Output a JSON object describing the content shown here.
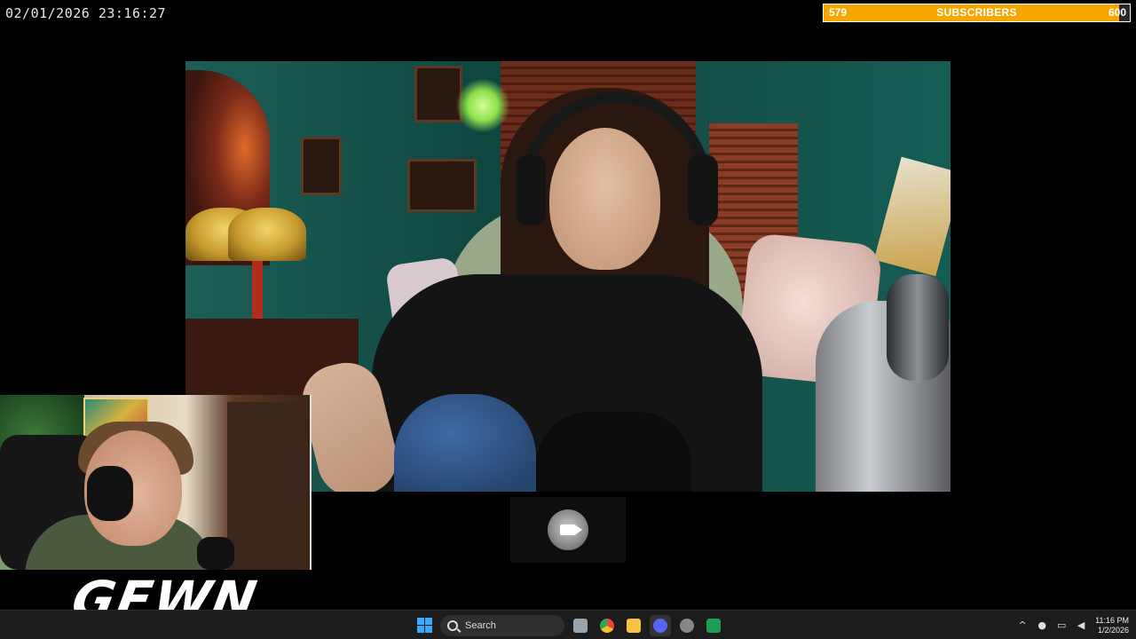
{
  "overlay": {
    "timestamp": "02/01/2026 23:16:27",
    "subscribers": {
      "current": "579",
      "label": "SUBSCRIBERS",
      "goal": "600",
      "progress_fraction": 0.965,
      "bar_color": "#f7a600"
    },
    "brand_logo_text": "GEWN"
  },
  "video_placeholder": {
    "icon": "camera-icon"
  },
  "taskbar": {
    "search_label": "Search",
    "pinned": [
      {
        "name": "file-explorer-icon",
        "color": "#f2c94c"
      },
      {
        "name": "chrome-icon",
        "color": "#e04a3a"
      },
      {
        "name": "folder-icon",
        "color": "#f5c243"
      },
      {
        "name": "discord-icon",
        "color": "#5865f2"
      },
      {
        "name": "app-icon",
        "color": "#bbbbbb"
      },
      {
        "name": "excel-icon",
        "color": "#1f9d55"
      }
    ],
    "clock": {
      "time": "11:16 PM",
      "date": "1/2/2026"
    }
  }
}
